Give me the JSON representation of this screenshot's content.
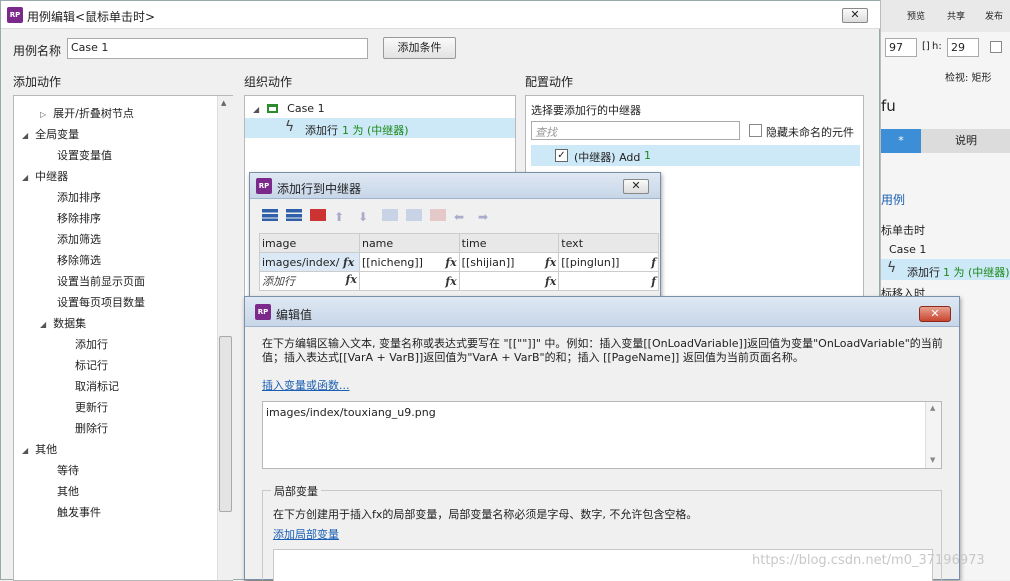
{
  "case_dialog": {
    "title": "用例编辑<鼠标单击时>",
    "close_label": "✕",
    "case_name_label": "用例名称",
    "case_name_value": "Case 1",
    "add_condition_label": "添加条件",
    "add_action_header": "添加动作",
    "organize_action_header": "组织动作",
    "configure_action_header": "配置动作",
    "action_tree": [
      {
        "label": "展开/折叠树节点",
        "toggle": "▷"
      },
      {
        "label": "全局变量",
        "toggle": "◢"
      },
      {
        "label": "设置变量值",
        "toggle": ""
      },
      {
        "label": "中继器",
        "toggle": "◢"
      },
      {
        "label": "添加排序",
        "toggle": ""
      },
      {
        "label": "移除排序",
        "toggle": ""
      },
      {
        "label": "添加筛选",
        "toggle": ""
      },
      {
        "label": "移除筛选",
        "toggle": ""
      },
      {
        "label": "设置当前显示页面",
        "toggle": ""
      },
      {
        "label": "设置每页项目数量",
        "toggle": ""
      },
      {
        "label": "数据集",
        "toggle": "◢"
      },
      {
        "label": "添加行",
        "toggle": ""
      },
      {
        "label": "标记行",
        "toggle": ""
      },
      {
        "label": "取消标记",
        "toggle": ""
      },
      {
        "label": "更新行",
        "toggle": ""
      },
      {
        "label": "删除行",
        "toggle": ""
      },
      {
        "label": "其他",
        "toggle": "◢"
      },
      {
        "label": "等待",
        "toggle": ""
      },
      {
        "label": "其他",
        "toggle": ""
      },
      {
        "label": "触发事件",
        "toggle": ""
      }
    ],
    "organize": {
      "case_label": "Case 1",
      "action_prefix": "添加行",
      "action_highlight": "1 为 (中继器)"
    },
    "configure": {
      "select_label": "选择要添加行的中继器",
      "search_placeholder": "查找",
      "hide_unnamed_label": "隐藏未命名的元件",
      "repeater_item_prefix": "(中继器) Add",
      "repeater_item_suffix": "1"
    }
  },
  "inspector": {
    "preview": "预览",
    "share": "共享",
    "publish": "发布",
    "w_value": "97",
    "h_label": "h:",
    "h_value": "29",
    "view_label": "检视: 矩形",
    "fu_text": "fu",
    "col_star": "*",
    "col_desc": "说明",
    "link_text": "用例",
    "event_click": "标单击时",
    "case_label": "Case 1",
    "action_prefix": "添加行",
    "action_highlight": "1 为 (中继器)",
    "event_move": "标移入时"
  },
  "add_row_dialog": {
    "title": "添加行到中继器",
    "close_label": "✕",
    "columns": [
      "image",
      "name",
      "time",
      "text"
    ],
    "row1": [
      "images/index/",
      "[[nicheng]]",
      "[[shijian]]",
      "[[pinglun]]"
    ],
    "add_row_label": "添加行",
    "fx_label": "fx",
    "more_col_fx": "f"
  },
  "edit_value_dialog": {
    "title": "编辑值",
    "close_label": "✕",
    "description": "在下方编辑区输入文本, 变量名称或表达式要写在 \"[[\"\"]]\" 中。例如：插入变量[[OnLoadVariable]]返回值为变量\"OnLoadVariable\"的当前值；插入表达式[[VarA + VarB]]返回值为\"VarA + VarB\"的和；插入 [[PageName]] 返回值为当前页面名称。",
    "insert_link": "插入变量或函数...",
    "editor_value": "images/index/touxiang_u9.png",
    "local_vars_legend": "局部变量",
    "local_vars_desc": "在下方创建用于插入fx的局部变量，局部变量名称必须是字母、数字, 不允许包含空格。",
    "add_local_var_link": "添加局部变量"
  },
  "watermark": "https://blog.csdn.net/m0_37196973",
  "colors": {
    "accent_purple": "#7b2a8c",
    "highlight": "#cde8f7",
    "link_blue": "#1a5fb4",
    "green_text": "#1b8a1b"
  }
}
